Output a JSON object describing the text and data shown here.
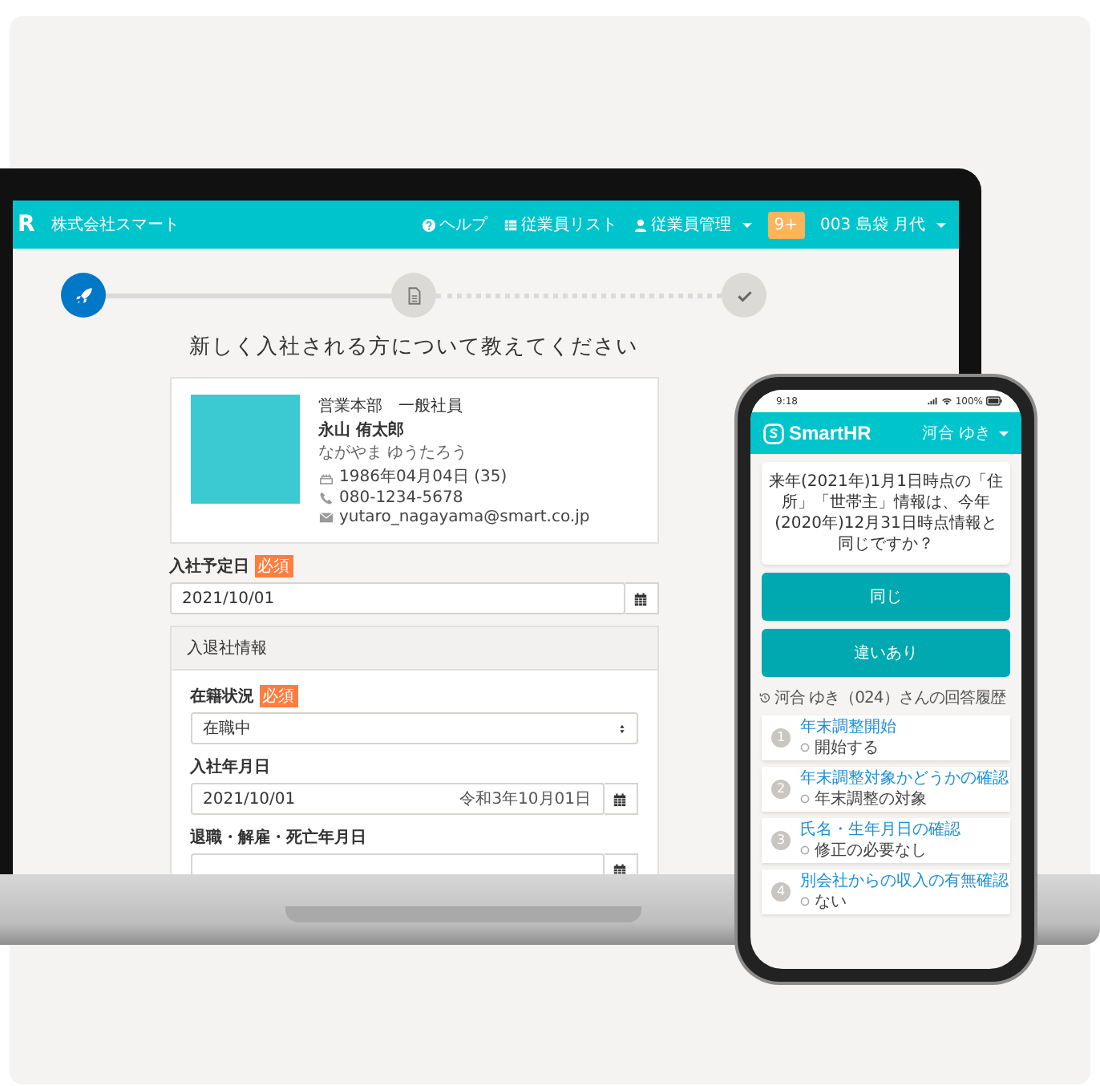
{
  "laptop": {
    "navbar": {
      "logo": "R",
      "company": "株式会社スマート",
      "items": [
        {
          "label": "ヘルプ",
          "dropdown": false
        },
        {
          "label": "従業員リスト",
          "dropdown": false
        },
        {
          "label": "従業員管理",
          "dropdown": true
        }
      ],
      "badge": "9+",
      "user": "003 島袋 月代"
    },
    "steps": [
      {
        "selected": true
      },
      {
        "selected": false
      },
      {
        "selected": false
      }
    ],
    "connectors": [
      {
        "kind": "solid"
      },
      {
        "kind": "dotted"
      }
    ],
    "heading": "新しく入社される方について教えてください",
    "profile": {
      "department": "営業本部　一般社員",
      "name": "永山 侑太郎",
      "kana": "ながやま ゆうたろう",
      "details": [
        {
          "text": "1986年04月04日 (35)"
        },
        {
          "text": "080-1234-5678"
        },
        {
          "text": "yutaro_nagayama@smart.co.jp"
        }
      ]
    },
    "join_date": {
      "label": "入社予定日",
      "required": "必須",
      "value": "2021/10/01"
    },
    "section": {
      "title": "入退社情報",
      "fields": [
        {
          "kind": "select",
          "label": "在籍状況",
          "required": "必須",
          "value": "在職中"
        },
        {
          "kind": "date",
          "label": "入社年月日",
          "value": "2021/10/01",
          "era": "令和3年10月01日"
        },
        {
          "kind": "date",
          "label": "退職・解雇・死亡年月日"
        }
      ]
    }
  },
  "phone": {
    "status": {
      "time": "9:18",
      "battery": "100%"
    },
    "brand": "SmartHR",
    "user": "河合 ゆき",
    "question": "来年(2021年)1月1日時点の「住所」「世帯主」情報は、今年(2020年)12月31日時点情報と同じですか？",
    "answers": [
      {
        "label": "同じ"
      },
      {
        "label": "違いあり"
      }
    ],
    "history_title": "河合 ゆき（024）さんの回答履歴",
    "history": [
      {
        "number": "1",
        "title": "年末調整開始",
        "answer": "開始する"
      },
      {
        "number": "2",
        "title": "年末調整対象かどうかの確認",
        "answer": "年末調整の対象"
      },
      {
        "number": "3",
        "title": "氏名・生年月日の確認",
        "answer": "修正の必要なし"
      },
      {
        "number": "4",
        "title": "別会社からの収入の有無確認",
        "answer": "ない"
      }
    ]
  }
}
